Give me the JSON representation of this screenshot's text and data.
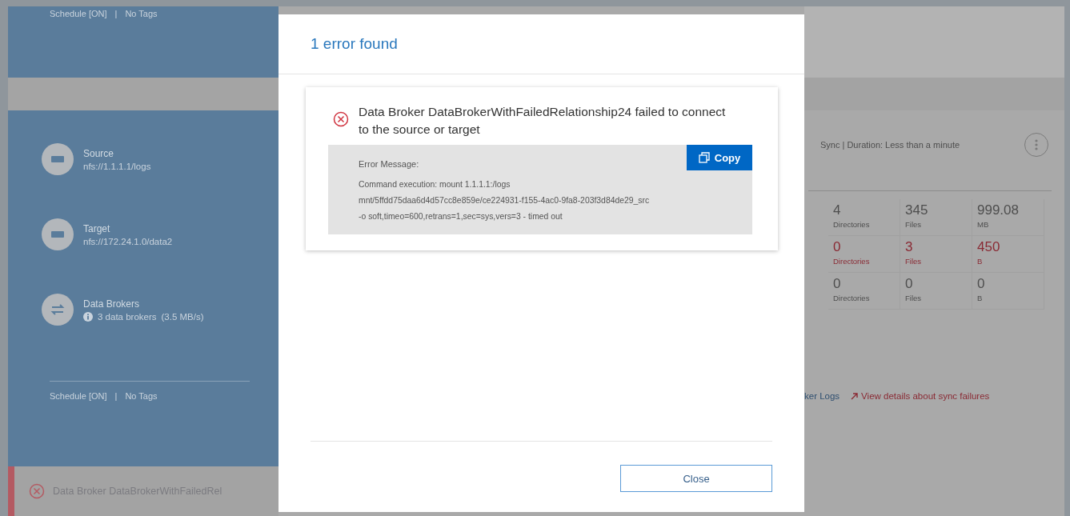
{
  "background": {
    "top_card": {
      "schedule": "Schedule [ON]",
      "separator": "|",
      "tags": "No Tags"
    },
    "relationship": {
      "endpoints": [
        {
          "kind": "storage",
          "label": "Source",
          "value": "nfs://1.1.1.1/logs"
        },
        {
          "kind": "storage",
          "label": "Target",
          "value": "nfs://172.24.1.0/data2"
        },
        {
          "kind": "brokers",
          "label": "Data Brokers",
          "value": "3 data brokers",
          "rate": "(3.5 MB/s)"
        }
      ],
      "schedule": "Schedule [ON]",
      "separator": "|",
      "tags": "No Tags"
    },
    "error_banner": {
      "text": "Data Broker DataBrokerWithFailedRel"
    },
    "sync_info": "Sync | Duration: Less than a minute",
    "stats": [
      [
        {
          "value": "4",
          "unit": "Directories",
          "failed": false
        },
        {
          "value": "345",
          "unit": "Files",
          "failed": false
        },
        {
          "value": "999.08",
          "unit": "MB",
          "failed": false
        }
      ],
      [
        {
          "value": "0",
          "unit": "Directories",
          "failed": true
        },
        {
          "value": "3",
          "unit": "Files",
          "failed": true
        },
        {
          "value": "450",
          "unit": "B",
          "failed": true
        }
      ],
      [
        {
          "value": "0",
          "unit": "Directories",
          "failed": false
        },
        {
          "value": "0",
          "unit": "Files",
          "failed": false
        },
        {
          "value": "0",
          "unit": "B",
          "failed": false
        }
      ]
    ],
    "links": [
      {
        "kind": "plain",
        "label": "ker Logs"
      },
      {
        "kind": "external",
        "label": "View details about sync failures"
      }
    ]
  },
  "dialog": {
    "title": "1 error found",
    "errors": [
      {
        "title": "Data Broker DataBrokerWithFailedRelationship24 failed to connect to the source or target",
        "message_label": "Error Message:",
        "message": "Command execution: mount 1.1.1.1:/logs\nmnt/5ffdd75daa6d4d57cc8e859e/ce224931-f155-4ac0-9fa8-203f3d84de29_src\n-o soft,timeo=600,retrans=1,sec=sys,vers=3 - timed out",
        "copy_label": "Copy"
      }
    ],
    "close_label": "Close"
  }
}
